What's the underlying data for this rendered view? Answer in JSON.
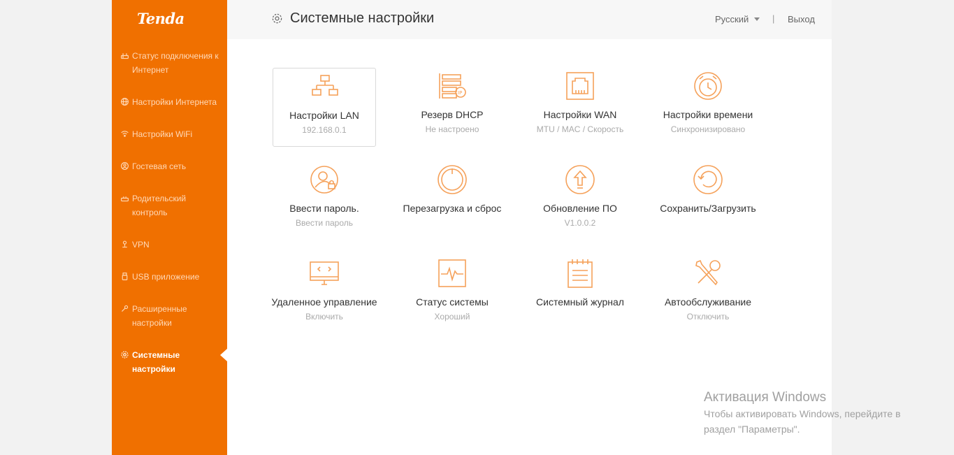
{
  "brand": {
    "logo_text": "Tenda",
    "accent_color": "#f07000"
  },
  "sidebar": {
    "items": [
      {
        "label": "Статус подключения к Интернет",
        "icon": "router-status-icon"
      },
      {
        "label": "Настройки Интернета",
        "icon": "globe-icon"
      },
      {
        "label": "Настройки WiFi",
        "icon": "wifi-icon"
      },
      {
        "label": "Гостевая сеть",
        "icon": "guest-network-icon"
      },
      {
        "label": "Родительский контроль",
        "icon": "parental-control-icon"
      },
      {
        "label": "VPN",
        "icon": "vpn-icon"
      },
      {
        "label": "USB приложение",
        "icon": "usb-icon"
      },
      {
        "label": "Расширенные настройки",
        "icon": "wrench-icon"
      },
      {
        "label": "Системные настройки",
        "icon": "gear-icon",
        "active": true
      }
    ]
  },
  "header": {
    "title": "Системные настройки",
    "language": "Русский",
    "separator": "|",
    "logout": "Выход"
  },
  "tiles": [
    {
      "label": "Настройки LAN",
      "sub": "192.168.0.1",
      "icon": "lan-topology-icon",
      "selected": true
    },
    {
      "label": "Резерв DHCP",
      "sub": "Не настроено",
      "icon": "dhcp-reservation-icon"
    },
    {
      "label": "Настройки WAN",
      "sub": "MTU / MAC / Скорость",
      "icon": "ethernet-port-icon"
    },
    {
      "label": "Настройки времени",
      "sub": "Синхронизировано",
      "icon": "alarm-clock-icon"
    },
    {
      "label": "Ввести пароль.",
      "sub": "Ввести пароль",
      "icon": "user-lock-icon"
    },
    {
      "label": "Перезагрузка и сброс",
      "sub": "",
      "icon": "power-icon"
    },
    {
      "label": "Обновление ПО",
      "sub": "V1.0.0.2",
      "icon": "upgrade-arrow-icon"
    },
    {
      "label": "Сохранить/Загрузить",
      "sub": "",
      "icon": "restore-icon"
    },
    {
      "label": "Удаленное управление",
      "sub": "Включить",
      "icon": "remote-monitor-icon"
    },
    {
      "label": "Статус системы",
      "sub": "Хороший",
      "icon": "heartbeat-monitor-icon"
    },
    {
      "label": "Системный журнал",
      "sub": "",
      "icon": "log-notepad-icon"
    },
    {
      "label": "Автообслуживание",
      "sub": "Отключить",
      "icon": "tools-icon"
    }
  ],
  "watermark": {
    "title": "Активация Windows",
    "line1": "Чтобы активировать Windows, перейдите в",
    "line2": "раздел \"Параметры\"."
  }
}
